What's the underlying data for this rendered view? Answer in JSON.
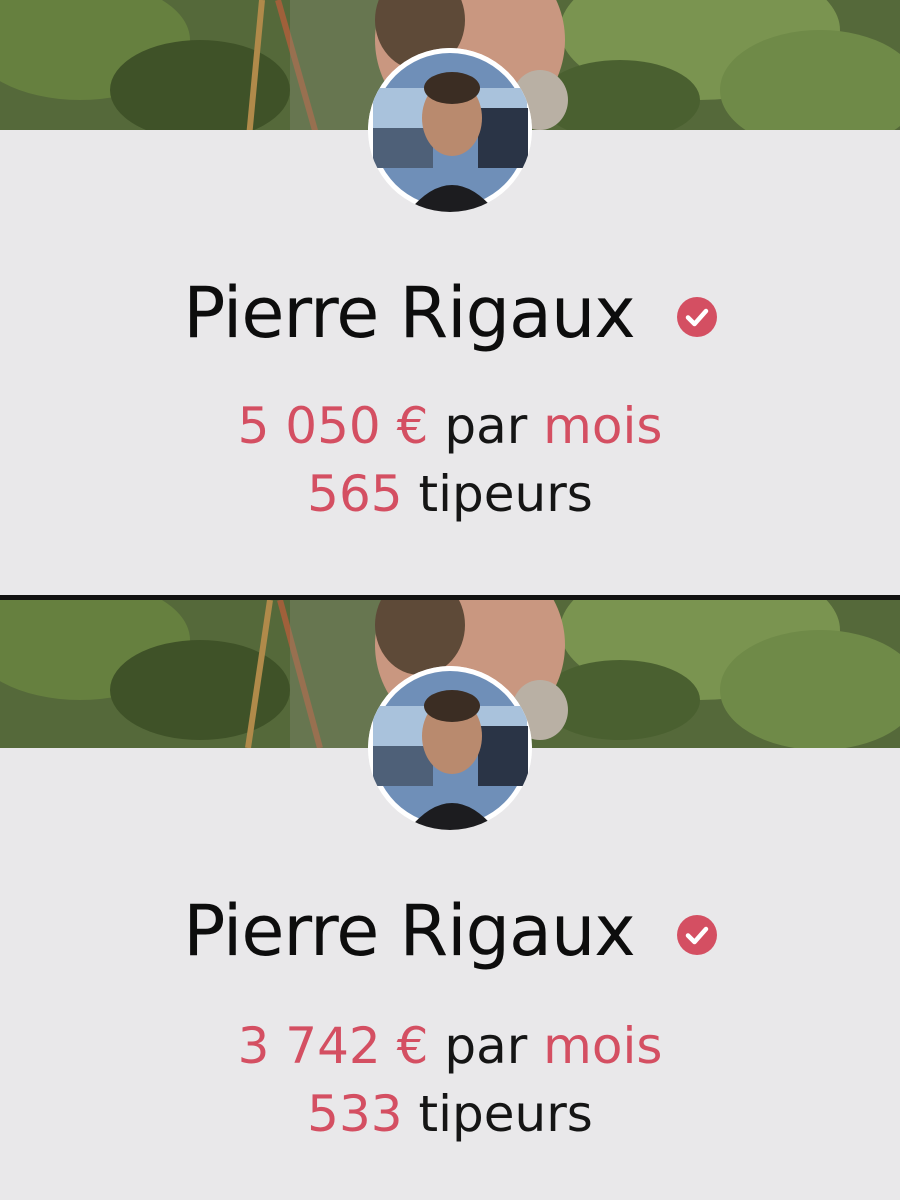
{
  "colors": {
    "accent": "#d44f62",
    "background": "#e9e8ea",
    "text": "#151515",
    "divider": "#111111"
  },
  "panels": [
    {
      "name": "Pierre Rigaux",
      "verified_icon": "check-circle-icon",
      "amount": "5 050 €",
      "per_label": "par",
      "period": "mois",
      "tippers_count": "565",
      "tippers_label": "tipeurs"
    },
    {
      "name": "Pierre Rigaux",
      "verified_icon": "check-circle-icon",
      "amount": "3 742 €",
      "per_label": "par",
      "period": "mois",
      "tippers_count": "533",
      "tippers_label": "tipeurs"
    }
  ]
}
